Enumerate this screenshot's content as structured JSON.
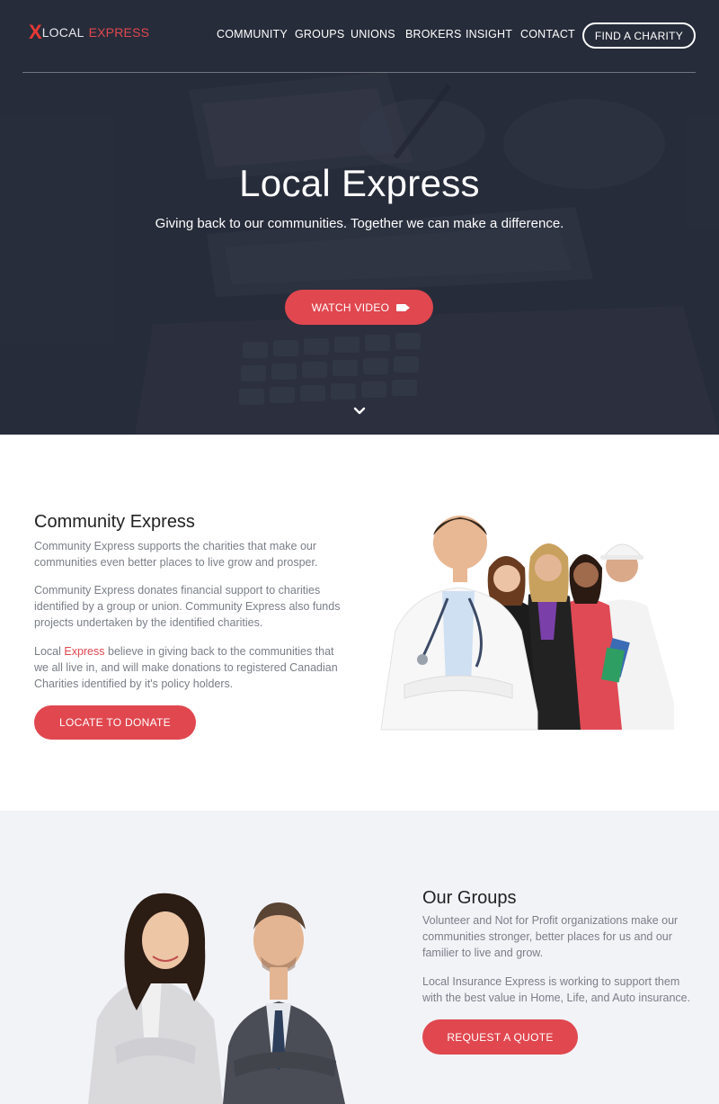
{
  "nav": {
    "logo_mark": "X",
    "logo_word1": "LOCAL",
    "logo_word2": "EXPRESS",
    "items": [
      "COMMUNITY",
      "GROUPS",
      "UNIONS",
      "BROKERS",
      "INSIGHT",
      "CONTACT"
    ],
    "cta": "FIND A CHARITY"
  },
  "hero": {
    "title": "Local Express",
    "subtitle": "Giving back to our communities. Together we can make a difference.",
    "button": "WATCH VIDEO"
  },
  "community": {
    "title": "Community Express",
    "p1": "Community Express supports the charities that make our communities even better places to live grow and prosper.",
    "p2": "Community Express donates financial support to charities identified by a group or union. Community Express also funds projects undertaken by the identified charities.",
    "p3_before": "Local ",
    "p3_accent": "Express",
    "p3_after": " believe in giving back to the communities that we all live in, and will make donations to registered Canadian Charities identified by it's policy holders.",
    "button": "LOCATE TO DONATE"
  },
  "groups": {
    "title": "Our Groups",
    "p1": "Volunteer and Not for Profit organizations make our communities stronger, better places for us and our familier to live and grow.",
    "p2": "Local Insurance Express is working to support them with the best value in Home, Life, and Auto insurance.",
    "button": "REQUEST A QUOTE"
  },
  "colors": {
    "accent": "#e0474f",
    "hero_bg": "#2c3140",
    "section_alt_bg": "#f2f3f7"
  }
}
